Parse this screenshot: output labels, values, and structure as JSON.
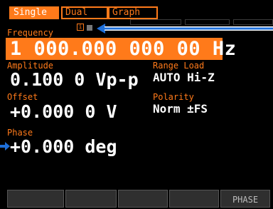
{
  "tabs": [
    {
      "label": "Single",
      "active": true
    },
    {
      "label": "Dual",
      "active": false
    },
    {
      "label": "Graph",
      "active": false
    }
  ],
  "frequency": {
    "label": "Frequency",
    "value": "1 000.000 000 00 Hz"
  },
  "indicator": {
    "text": "i"
  },
  "amplitude": {
    "label": "Amplitude",
    "value": "0.100 0 Vp-p"
  },
  "range_load": {
    "label": "Range Load",
    "value": "AUTO Hi-Z"
  },
  "offset": {
    "label": "Offset",
    "value": "+0.000 0 V"
  },
  "polarity": {
    "label": "Polarity",
    "value": "Norm ±FS"
  },
  "phase": {
    "label": "Phase",
    "value": "+0.000 deg"
  },
  "softkeys": [
    "",
    "",
    "",
    "",
    "PHASE"
  ],
  "colors": {
    "accent": "#ff7a1a",
    "arrow": "#1e6fd9",
    "background": "#000000"
  }
}
